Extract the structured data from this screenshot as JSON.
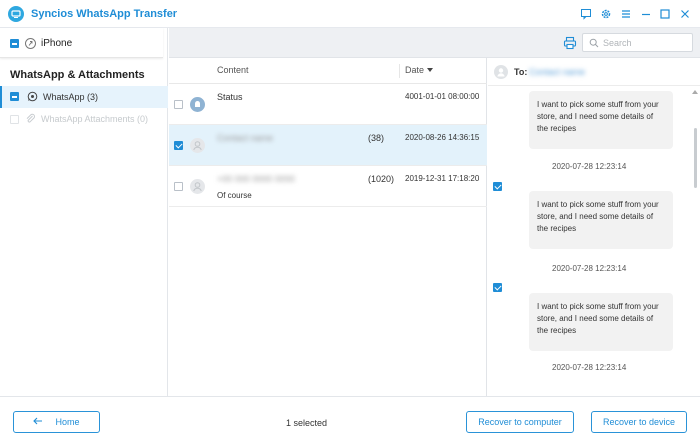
{
  "app": {
    "title": "Syncios WhatsApp Transfer",
    "accent": "#1f8dd6"
  },
  "window_buttons": [
    "feedback-icon",
    "gear-icon",
    "menu-icon",
    "minimize-icon",
    "maximize-icon",
    "close-icon"
  ],
  "device": {
    "name": "iPhone"
  },
  "sidebar": {
    "section_title": "WhatsApp & Attachments",
    "items": [
      {
        "label": "WhatsApp (3)",
        "icon": "whatsapp-icon",
        "active": true
      },
      {
        "label": "WhatsApp Attachments (0)",
        "icon": "paperclip-icon",
        "disabled": true
      }
    ]
  },
  "toolbar": {
    "search_placeholder": "Search"
  },
  "list": {
    "columns": {
      "content": "Content",
      "date": "Date"
    },
    "rows": [
      {
        "name": "Status",
        "count": "",
        "date": "4001-01-01 08:00:00",
        "sub": "",
        "checked": false,
        "blurred": false
      },
      {
        "name": "Contact name",
        "count": "(38)",
        "date": "2020-08-26 14:36:15",
        "sub": "",
        "checked": true,
        "blurred": true
      },
      {
        "name": "+00 000 0000 0000",
        "count": "(1020)",
        "date": "2019-12-31 17:18:20",
        "sub": "Of course",
        "checked": false,
        "blurred": true
      }
    ]
  },
  "chat": {
    "to_label": "To:",
    "to_value": "Contact name",
    "messages": [
      {
        "text": "I want to pick some stuff from your store, and I need some details of the recipes",
        "time": "2020-07-28 12:23:14",
        "checked": true
      },
      {
        "text": "I want to pick some stuff from your store, and I need some details of the recipes",
        "time": "2020-07-28 12:23:14",
        "checked": true
      },
      {
        "text": "I want to pick some stuff from your store, and I need some details of the recipes",
        "time": "2020-07-28 12:23:14",
        "checked": true
      }
    ]
  },
  "footer": {
    "home_label": "Home",
    "selected_text": "1 selected",
    "recover_computer_label": "Recover to computer",
    "recover_device_label": "Recover to device"
  }
}
